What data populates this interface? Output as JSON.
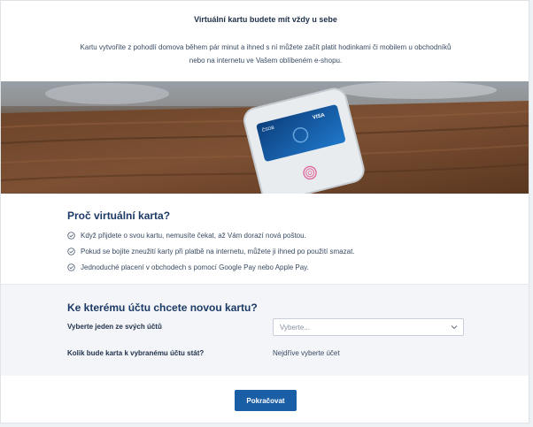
{
  "intro": {
    "title": "Virtuální kartu budete mít vždy u sebe",
    "text": "Kartu vytvoříte z pohodlí domova během pár minut a ihned s ní můžete začít platit hodinkami či mobilem u obchodníků nebo na internetu ve Vašem oblíbeném e-shopu."
  },
  "hero": {
    "image": "phone-with-virtual-card-on-wooden-table",
    "card_brand": "VISA",
    "card_bank": "ČSOB"
  },
  "why": {
    "title": "Proč virtuální karta?",
    "items": [
      "Když přijdete o svou kartu, nemusíte čekat, až Vám dorazí nová poštou.",
      "Pokud se bojíte zneužití karty při platbě na internetu, můžete ji ihned po použití smazat.",
      "Jednoduché placení v obchodech s pomocí Google Pay nebo Apple Pay."
    ]
  },
  "account": {
    "title": "Ke kterému účtu chcete novou kartu?",
    "select_label": "Vyberte jeden ze svých účtů",
    "select_placeholder": "Vyberte...",
    "price_label": "Kolik bude karta k vybranému účtu stát?",
    "price_value": "Nejdříve vyberte účet"
  },
  "footer": {
    "continue_label": "Pokračovat"
  },
  "colors": {
    "primary": "#1a5ea6",
    "heading": "#1c3a66",
    "section_bg": "#f3f5f8"
  }
}
